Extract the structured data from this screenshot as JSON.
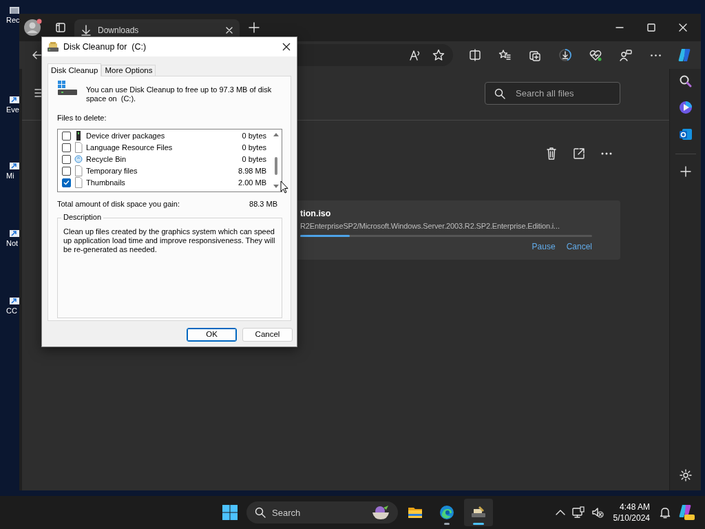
{
  "desktop": {
    "icons": [
      {
        "label": "Rec",
        "kind": "recycle"
      },
      {
        "label": "Eve",
        "kind": "shortcut"
      },
      {
        "label": "Mi",
        "kind": "shortcut"
      },
      {
        "label": "Not",
        "kind": "notepad"
      },
      {
        "label": "CC",
        "kind": "shortcut"
      }
    ]
  },
  "browser": {
    "tabs": [
      {
        "title": "Downloads",
        "selected": true
      }
    ],
    "downloads": {
      "search": {
        "placeholder": "Search all files"
      },
      "items": [
        {
          "filename": "tion.iso",
          "url": "R2EnterpriseSP2/Microsoft.Windows.Server.2003.R2.SP2.Enterprise.Edition.i...",
          "level": 0.17,
          "actions": [
            "Pause",
            "Cancel"
          ]
        }
      ]
    }
  },
  "dialog": {
    "title": "Disk Cleanup for  (C:)",
    "tabs": [
      {
        "label": "Disk Cleanup",
        "selected": true
      },
      {
        "label": "More Options",
        "selected": false
      }
    ],
    "intro": "You can use Disk Cleanup to free up to 97.3 MB of disk space on  (C:).",
    "files_label": "Files to delete:",
    "files": [
      {
        "name": "Device driver packages",
        "size": "0 bytes",
        "checked": false,
        "kind": "driver"
      },
      {
        "name": "Language Resource Files",
        "size": "0 bytes",
        "checked": false,
        "kind": "page"
      },
      {
        "name": "Recycle Bin",
        "size": "0 bytes",
        "checked": false,
        "kind": "recycle"
      },
      {
        "name": "Temporary files",
        "size": "8.98 MB",
        "checked": false,
        "kind": "page"
      },
      {
        "name": "Thumbnails",
        "size": "2.00 MB",
        "checked": true,
        "kind": "page"
      }
    ],
    "total_label": "Total amount of disk space you gain:",
    "total": "88.3 MB",
    "description_label": "Description",
    "description": "Clean up files created by the graphics system which can speed up application load time and improve responsiveness. They will be re-generated as needed.",
    "buttons": [
      {
        "label": "OK",
        "default": true
      },
      {
        "label": "Cancel",
        "default": false
      }
    ]
  },
  "taskbar": {
    "search": {
      "placeholder": "Search"
    },
    "apps": [
      {
        "kind": "folder",
        "running": false,
        "selected": false
      },
      {
        "kind": "edge",
        "running": true,
        "selected": false
      },
      {
        "kind": "cleanup",
        "running": true,
        "selected": true
      }
    ],
    "time": "4:48 AM",
    "date": "5/10/2024"
  }
}
